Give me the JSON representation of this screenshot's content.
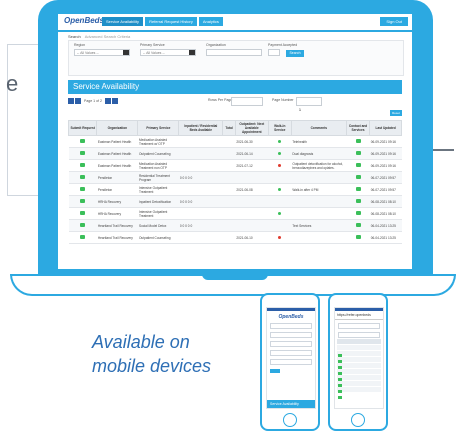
{
  "background": {
    "partial_text": "e"
  },
  "app": {
    "logo": "OpenBeds",
    "nav_tabs": [
      "Service Availability",
      "Referral Request History",
      "Analytics"
    ],
    "nav_button": "Sign Out"
  },
  "search": {
    "tabs": [
      "Search",
      "Advanced Search Criteria"
    ],
    "fields": [
      {
        "label": "Region",
        "value": "-- All Values --"
      },
      {
        "label": "Primary Service",
        "value": "-- All Values --"
      },
      {
        "label": "Organization",
        "value": ""
      },
      {
        "label": "Payment Accepted",
        "value": ""
      }
    ],
    "search_button": "Search"
  },
  "section_title": "Service Availability",
  "pager": {
    "info": "Page 1 of 2",
    "rows_per_page_label": "Rows Per Page",
    "page_number_label": "Page Number",
    "page_number_value": "1"
  },
  "reset_button": "Reset",
  "table": {
    "headers": [
      "Submit Request",
      "Organization",
      "Primary Service",
      "Inpatient / Residential Beds Available",
      "Total",
      "Outpatient: Next Available Appointment",
      "Walk-In Service",
      "Comments",
      "Contact and Services",
      "Last Updated"
    ],
    "rows": [
      {
        "org": "Eastman Patient Health",
        "service": "Medication Assisted Treatment w/ OTP",
        "beds": "",
        "next": "2021-06-30",
        "walkin": "green",
        "comments": "Telehealth",
        "updated": "06-09-2021 09:16"
      },
      {
        "org": "Eastman Patient Health",
        "service": "Outpatient Counseling",
        "beds": "",
        "next": "2021-06-14",
        "walkin": "green",
        "comments": "Dual diagnosis",
        "updated": "06-09-2021 09:16"
      },
      {
        "org": "Eastman Patient Health",
        "service": "Medication Assisted Treatment non OTP",
        "beds": "",
        "next": "2021-07-12",
        "walkin": "red",
        "comments": "Outpatient detoxification for alcohol, benzodiazepines and opiates.",
        "updated": "06-09-2021 09:16"
      },
      {
        "org": "Pendleton",
        "service": "Residential Treatment Program",
        "beds": "0 0 0 0 0",
        "next": "",
        "walkin": "",
        "comments": "",
        "updated": "06-07-2021 09:57"
      },
      {
        "org": "Pendleton",
        "service": "Intensive Outpatient Treatment",
        "beds": "",
        "next": "2021-06-08",
        "walkin": "green",
        "comments": "Walk-in after 4 PM",
        "updated": "06-07-2021 09:57"
      },
      {
        "org": "HRHA Recovery",
        "service": "Inpatient Detoxification",
        "beds": "0 0 0 0 0",
        "next": "",
        "walkin": "",
        "comments": "",
        "updated": "06-08-2021 08:10"
      },
      {
        "org": "HRHA Recovery",
        "service": "Intensive Outpatient Treatment",
        "beds": "",
        "next": "",
        "walkin": "green",
        "comments": "",
        "updated": "06-08-2021 08:10"
      },
      {
        "org": "Heartland Trail Recovery",
        "service": "Social Model Detox",
        "beds": "0 0 0 0 0",
        "next": "",
        "walkin": "",
        "comments": "Text Services",
        "updated": "06-04-2021 13:25"
      },
      {
        "org": "Heartland Trail Recovery",
        "service": "Outpatient Counseling",
        "beds": "",
        "next": "2021-06-10",
        "walkin": "red",
        "comments": "",
        "updated": "06-04-2021 13:25"
      }
    ]
  },
  "promo_text": "Available on mobile devices",
  "phone_left": {
    "logo": "OpenBeds",
    "footer": "Service Availability"
  },
  "phone_right": {
    "url": "https://refer.openbeds"
  },
  "colors": {
    "accent": "#2ca9e1",
    "brand_dark": "#2b5ea8",
    "green": "#3bbf5a",
    "red": "#e03b2f"
  }
}
